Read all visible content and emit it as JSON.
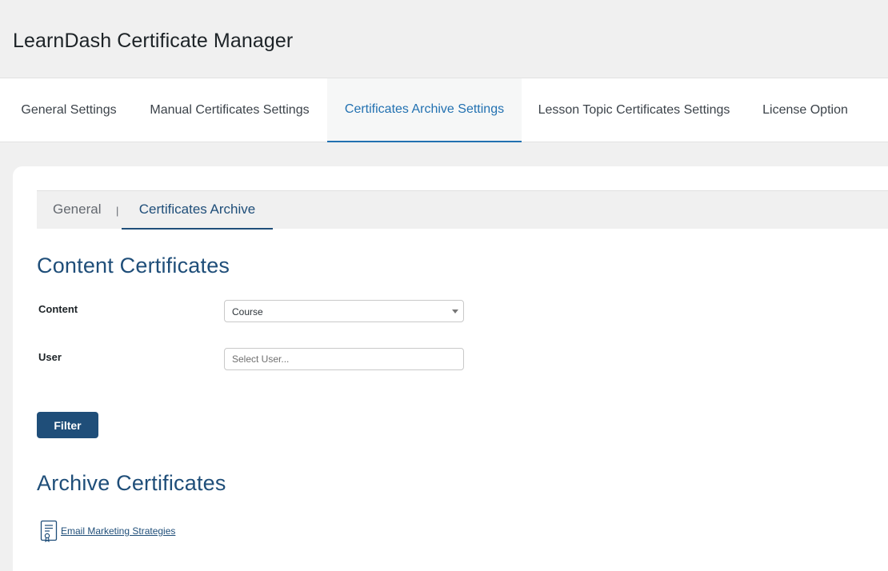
{
  "app": {
    "title": "LearnDash Certificate Manager"
  },
  "main_tabs": [
    {
      "label": "General Settings",
      "active": false
    },
    {
      "label": "Manual Certificates Settings",
      "active": false
    },
    {
      "label": "Certificates Archive Settings",
      "active": true
    },
    {
      "label": "Lesson Topic Certificates Settings",
      "active": false
    },
    {
      "label": "License Option",
      "active": false
    }
  ],
  "sub_tabs": {
    "items": [
      {
        "label": "General",
        "active": false
      },
      {
        "label": "Certificates Archive",
        "active": true
      }
    ],
    "separator": "|"
  },
  "content_certificates": {
    "heading": "Content Certificates",
    "content_label": "Content",
    "content_value": "Course",
    "user_label": "User",
    "user_placeholder": "Select User...",
    "filter_label": "Filter"
  },
  "archive_certificates": {
    "heading": "Archive Certificates",
    "items": [
      {
        "label": "Email Marketing Strategies",
        "icon": "certificate-icon"
      }
    ]
  },
  "colors": {
    "accent": "#2271b1",
    "brand_dark": "#1f4e79",
    "background": "#f0f0f0"
  }
}
